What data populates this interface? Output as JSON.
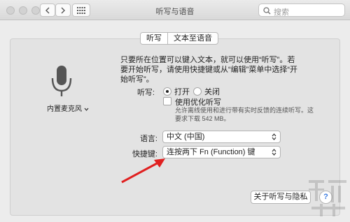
{
  "window": {
    "title": "听写与语音"
  },
  "search": {
    "placeholder": "搜索"
  },
  "tabs": [
    {
      "label": "听写",
      "active": true
    },
    {
      "label": "文本至语音",
      "active": false
    }
  ],
  "microphone": {
    "label": "内置麦克风"
  },
  "description": "只要所在位置可以键入文本，就可以使用“听写”。若要开始听写，请使用快捷键或从“编辑”菜单中选择“开始听写”。",
  "dictation": {
    "label": "听写:",
    "on_label": "打开",
    "off_label": "关闭",
    "selected": "打开"
  },
  "enhanced": {
    "label": "使用优化听写",
    "checked": false,
    "description": "允许离线使用和进行带有实时反馈的连续听写。这要求下载 542 MB。"
  },
  "language": {
    "label": "语言:",
    "value": "中文 (中国)"
  },
  "shortcut": {
    "label": "快捷键:",
    "value": "连按两下 Fn (Function) 键"
  },
  "about_button": "关于听写与隐私",
  "help_button": "?",
  "colors": {
    "arrow": "#e02020",
    "help": "#3a7be0"
  }
}
